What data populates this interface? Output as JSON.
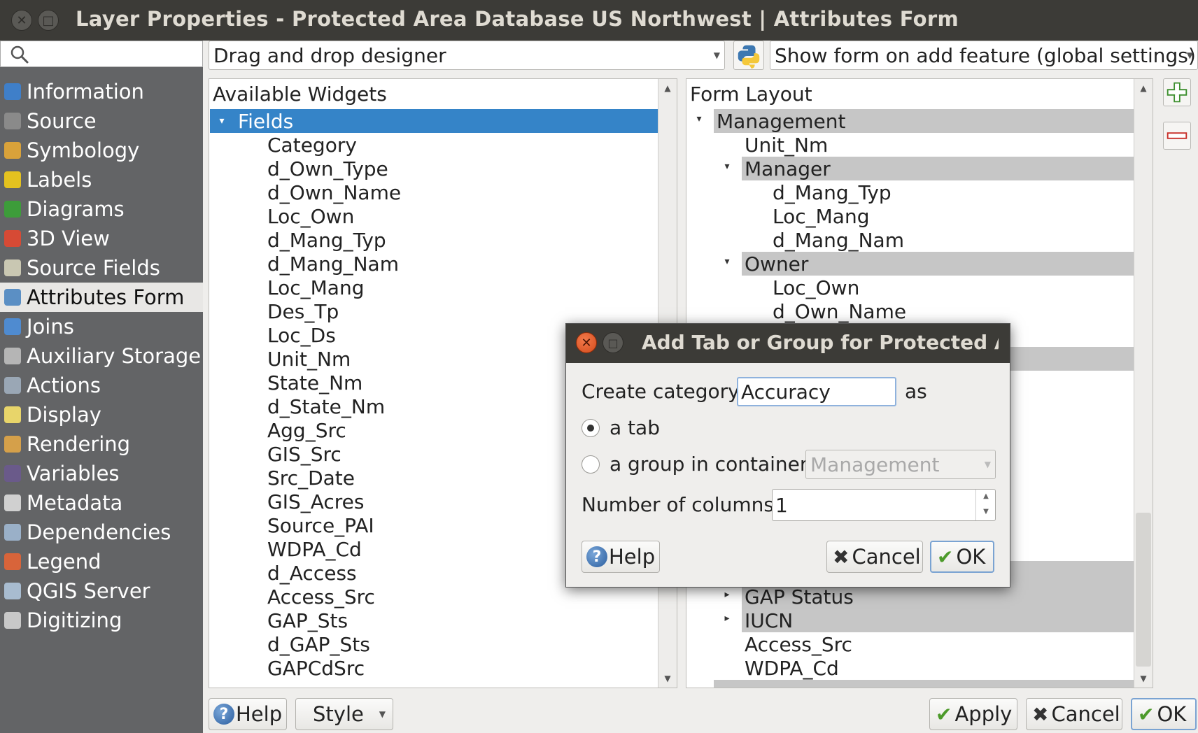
{
  "window": {
    "title": "Layer Properties - Protected Area Database US Northwest | Attributes Form"
  },
  "sidebar": {
    "search_placeholder": "",
    "items": [
      {
        "label": "Information",
        "icon": "info-icon",
        "color": "#3f7fc9"
      },
      {
        "label": "Source",
        "icon": "source-icon",
        "color": "#8a8a8a"
      },
      {
        "label": "Symbology",
        "icon": "symbology-icon",
        "color": "#d9a23a"
      },
      {
        "label": "Labels",
        "icon": "labels-icon",
        "color": "#e4c21f"
      },
      {
        "label": "Diagrams",
        "icon": "diagrams-icon",
        "color": "#3d9c3a"
      },
      {
        "label": "3D View",
        "icon": "3d-view-icon",
        "color": "#d64a35"
      },
      {
        "label": "Source Fields",
        "icon": "source-fields-icon",
        "color": "#c9c7b2"
      },
      {
        "label": "Attributes Form",
        "icon": "attributes-form-icon",
        "color": "#5b8fc4"
      },
      {
        "label": "Joins",
        "icon": "joins-icon",
        "color": "#4f8bd0"
      },
      {
        "label": "Auxiliary Storage",
        "icon": "auxiliary-storage-icon",
        "color": "#b5b5b5"
      },
      {
        "label": "Actions",
        "icon": "actions-icon",
        "color": "#9aa7b5"
      },
      {
        "label": "Display",
        "icon": "display-icon",
        "color": "#e8d56a"
      },
      {
        "label": "Rendering",
        "icon": "rendering-icon",
        "color": "#d5a04a"
      },
      {
        "label": "Variables",
        "icon": "variables-icon",
        "color": "#6a5a8a"
      },
      {
        "label": "Metadata",
        "icon": "metadata-icon",
        "color": "#d0d0d0"
      },
      {
        "label": "Dependencies",
        "icon": "dependencies-icon",
        "color": "#9ab0c8"
      },
      {
        "label": "Legend",
        "icon": "legend-icon",
        "color": "#d8643a"
      },
      {
        "label": "QGIS Server",
        "icon": "qgis-server-icon",
        "color": "#a8bcd0"
      },
      {
        "label": "Digitizing",
        "icon": "digitizing-icon",
        "color": "#c8c8c8"
      }
    ]
  },
  "toolbar": {
    "designer_mode": "Drag and drop designer",
    "python_icon": "python-icon",
    "suppress_form": "Show form on add feature (global settings)"
  },
  "available_widgets": {
    "header": "Available Widgets",
    "group": "Fields",
    "fields": [
      "Category",
      "d_Own_Type",
      "d_Own_Name",
      "Loc_Own",
      "d_Mang_Typ",
      "d_Mang_Nam",
      "Loc_Mang",
      "Des_Tp",
      "Loc_Ds",
      "Unit_Nm",
      "State_Nm",
      "d_State_Nm",
      "Agg_Src",
      "GIS_Src",
      "Src_Date",
      "GIS_Acres",
      "Source_PAI",
      "WDPA_Cd",
      "d_Access",
      "Access_Src",
      "GAP_Sts",
      "d_GAP_Sts",
      "GAPCdSrc"
    ]
  },
  "form_layout": {
    "header": "Form Layout",
    "rows": [
      {
        "label": "Management",
        "level": 0,
        "group": true,
        "expanded": true
      },
      {
        "label": "Unit_Nm",
        "level": 1,
        "group": false
      },
      {
        "label": "Manager",
        "level": 1,
        "group": true,
        "expanded": true
      },
      {
        "label": "d_Mang_Typ",
        "level": 2,
        "group": false
      },
      {
        "label": "Loc_Mang",
        "level": 2,
        "group": false
      },
      {
        "label": "d_Mang_Nam",
        "level": 2,
        "group": false
      },
      {
        "label": "Owner",
        "level": 1,
        "group": true,
        "expanded": true
      },
      {
        "label": "Loc_Own",
        "level": 2,
        "group": false
      },
      {
        "label": "d_Own_Name",
        "level": 2,
        "group": false
      }
    ],
    "rows_bottom": [
      {
        "label": "GAP Status",
        "level": 1,
        "group": true,
        "expanded": false
      },
      {
        "label": "IUCN",
        "level": 1,
        "group": true,
        "expanded": false
      },
      {
        "label": "Access_Src",
        "level": 1,
        "group": false
      },
      {
        "label": "WDPA_Cd",
        "level": 1,
        "group": false
      }
    ]
  },
  "dialog": {
    "title": "Add Tab or Group for Protected Are",
    "create_category_label": "Create category",
    "category_value": "Accuracy",
    "as_label": "as",
    "option_tab": "a tab",
    "option_group": "a group in container",
    "container_value": "Management",
    "columns_label": "Number of columns",
    "columns_value": "1",
    "help": "Help",
    "cancel": "Cancel",
    "ok": "OK"
  },
  "footer": {
    "help": "Help",
    "style": "Style",
    "apply": "Apply",
    "cancel": "Cancel",
    "ok": "OK"
  }
}
